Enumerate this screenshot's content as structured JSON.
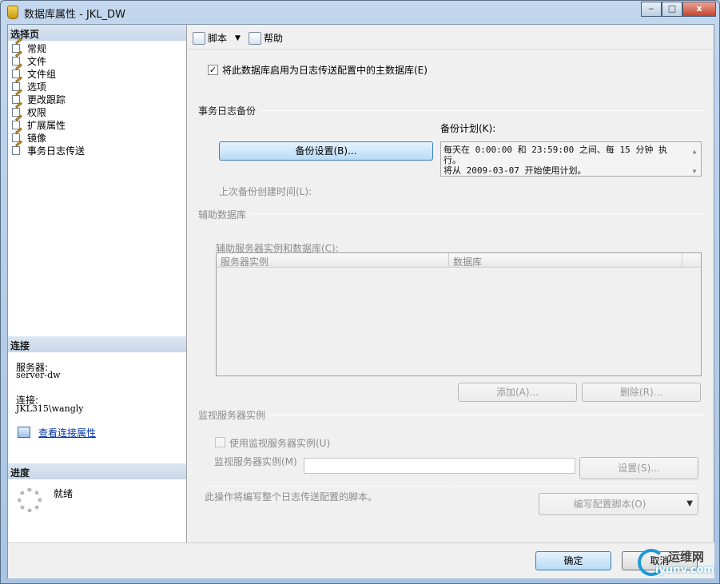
{
  "window": {
    "title": "数据库属性 - JKL_DW",
    "minimize": "‒",
    "maximize": "□",
    "close": "x"
  },
  "left": {
    "select_page_header": "选择页",
    "pages": [
      "常规",
      "文件",
      "文件组",
      "选项",
      "更改跟踪",
      "权限",
      "扩展属性",
      "镜像",
      "事务日志传送"
    ],
    "connection_header": "连接",
    "server_label": "服务器:",
    "server_value": "server-dw",
    "connection_label": "连接:",
    "connection_value": "JKL315\\wangly",
    "view_connection_link": "查看连接属性",
    "progress_header": "进度",
    "progress_status": "就绪"
  },
  "toolbar": {
    "script_label": "脚本",
    "help_label": "帮助"
  },
  "main": {
    "enable_primary_checkbox": "将此数据库启用为日志传送配置中的主数据库(E)",
    "enable_primary_checked": "✓",
    "tlog_group": "事务日志备份",
    "schedule_label": "备份计划(K):",
    "backup_settings_button": "备份设置(B)...",
    "schedule_text_line1": "每天在 0:00:00 和 23:59:00 之间、每 15 分钟 执行。",
    "schedule_text_line2": "将从 2009-03-07 开始使用计划。",
    "scroll_up": "▲",
    "scroll_down": "▼",
    "last_backup_label": "上次备份创建时间(L):",
    "secondary_group": "辅助数据库",
    "secondary_list_label": "辅助服务器实例和数据库(C):",
    "grid_columns": [
      "服务器实例",
      "数据库"
    ],
    "add_button": "添加(A)...",
    "remove_button": "删除(R)...",
    "monitor_group": "监视服务器实例",
    "use_monitor_checkbox": "使用监视服务器实例(U)",
    "monitor_instance_label": "监视服务器实例(M)",
    "settings_button": "设置(S)...",
    "script_note": "此操作将编写整个日志传送配置的脚本。",
    "script_config_button": "编写配置脚本(O)",
    "dropdown_arrow": "▼"
  },
  "footer": {
    "ok_button": "确定",
    "cancel_button": "取消"
  },
  "watermark": {
    "title": "运维网",
    "url": "iyunv.com"
  },
  "colors": {
    "accent_blue": "#3c7fb1",
    "panel_header": "#c8d7ea",
    "link": "#0033aa"
  }
}
